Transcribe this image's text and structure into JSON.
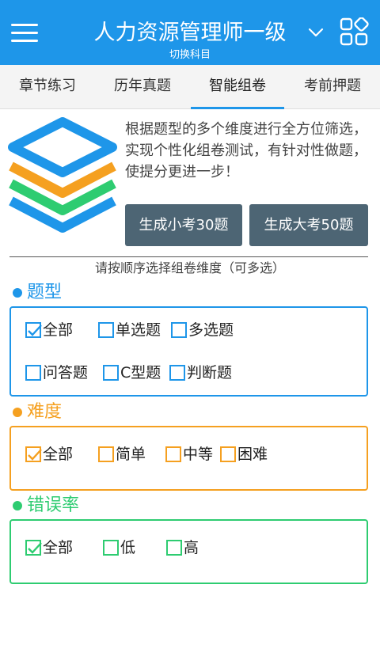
{
  "header": {
    "title": "人力资源管理师一级",
    "subtitle": "切换科目",
    "menu_icon": "hamburger-menu-icon",
    "switch_icon": "chevron-down-icon",
    "grid_icon": "grid-apps-icon",
    "bg_color": "#1e96e9"
  },
  "tabs": [
    {
      "label": "章节练习",
      "active": false
    },
    {
      "label": "历年真题",
      "active": false
    },
    {
      "label": "智能组卷",
      "active": true
    },
    {
      "label": "考前押题",
      "active": false
    }
  ],
  "intro": {
    "icon": "stacked-layers-icon",
    "text": "根据题型的多个维度进行全方位筛选，实现个性化组卷测试，有针对性做题，使提分更进一步！",
    "btn_small": "生成小考30题",
    "btn_large": "生成大考50题"
  },
  "hint": "请按顺序选择组卷维度（可多选）",
  "sections": {
    "type": {
      "title": "题型",
      "color": "#1e96e9",
      "options": [
        {
          "label": "全部",
          "checked": true
        },
        {
          "label": "单选题",
          "checked": false
        },
        {
          "label": "多选题",
          "checked": false
        },
        {
          "label": "问答题",
          "checked": false
        },
        {
          "label": "C型题",
          "checked": false
        },
        {
          "label": "判断题",
          "checked": false
        }
      ]
    },
    "difficulty": {
      "title": "难度",
      "color": "#f5a020",
      "options": [
        {
          "label": "全部",
          "checked": true
        },
        {
          "label": "简单",
          "checked": false
        },
        {
          "label": "中等",
          "checked": false
        },
        {
          "label": "困难",
          "checked": false
        }
      ]
    },
    "error_rate": {
      "title": "错误率",
      "color": "#2ecc71",
      "options": [
        {
          "label": "全部",
          "checked": true
        },
        {
          "label": "低",
          "checked": false
        },
        {
          "label": "高",
          "checked": false
        }
      ]
    }
  }
}
